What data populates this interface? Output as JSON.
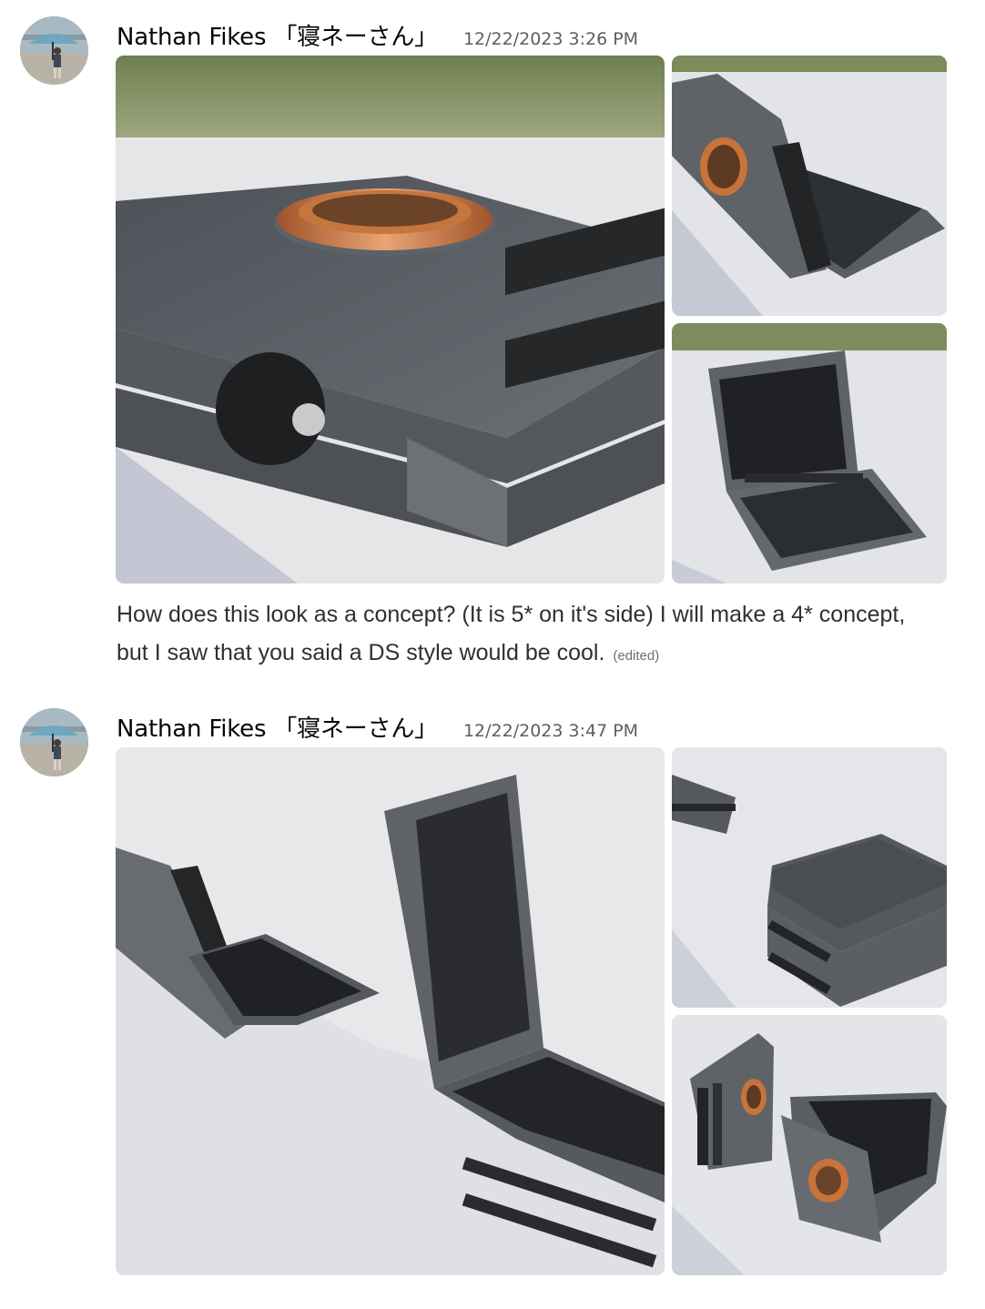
{
  "messages": [
    {
      "author": "Nathan Fikes 「寝ネーさん」",
      "timestamp": "12/22/2023 3:26 PM",
      "text": "How does this look as a concept? (It is 5* on it's side) I will make a 4* concept, but I saw that you said a DS style would be cool.",
      "edited_label": "(edited)",
      "attachments": [
        {
          "subject": "closed-device-with-copper-ring-closeup"
        },
        {
          "subject": "open-device-side-view"
        },
        {
          "subject": "open-device-screens-view"
        }
      ]
    },
    {
      "author": "Nathan Fikes 「寝ネーさん」",
      "timestamp": "12/22/2023 3:47 PM",
      "attachments": [
        {
          "subject": "two-open-devices-perspective"
        },
        {
          "subject": "closed-devices-stacked"
        },
        {
          "subject": "two-devices-with-copper-rings"
        }
      ]
    }
  ],
  "colors": {
    "author": "#060607",
    "timestamp": "#5c5e66",
    "body_text": "#2e3035",
    "device_metal": "#5a5e63",
    "copper": "#c8733a"
  }
}
